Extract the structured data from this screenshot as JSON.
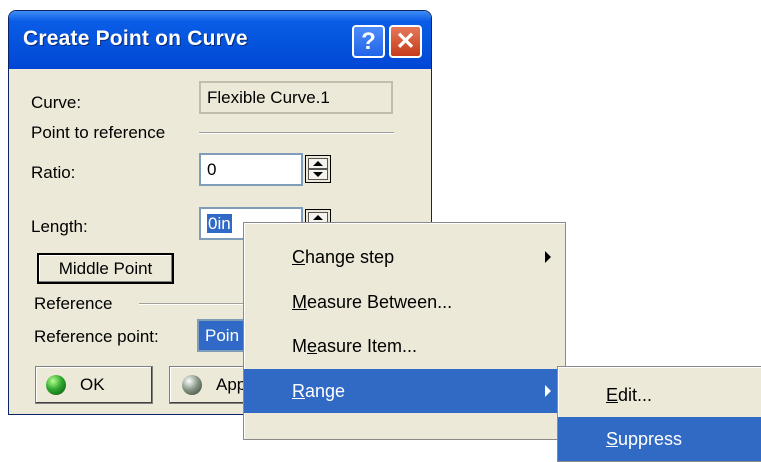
{
  "dialog": {
    "title": "Create Point on Curve",
    "help_glyph": "?",
    "close_glyph": "✕",
    "curve_label": "Curve:",
    "curve_value": "Flexible Curve.1",
    "point_to_reference_label": "Point to reference",
    "ratio_label": "Ratio:",
    "ratio_value": "0",
    "length_label": "Length:",
    "length_value": "0in",
    "middle_point_label": "Middle Point",
    "reference_label": "Reference",
    "reference_point_label": "Reference point:",
    "reference_point_value": "Poin",
    "ok_label": "OK",
    "apply_label": "App"
  },
  "context_menu": {
    "items": [
      {
        "label_first": "C",
        "label_rest": "hange step",
        "has_submenu": true
      },
      {
        "label_first": "M",
        "label_rest": "easure Between...",
        "has_submenu": false
      },
      {
        "label_pre": "M",
        "label_first": "e",
        "label_rest": "asure Item...",
        "has_submenu": false
      },
      {
        "label_first": "R",
        "label_rest": "ange",
        "has_submenu": true,
        "highlighted": true
      }
    ]
  },
  "submenu": {
    "items": [
      {
        "label_first": "E",
        "label_rest": "dit..."
      },
      {
        "label_first": "S",
        "label_rest": "uppress",
        "highlighted": true
      }
    ]
  },
  "colors": {
    "titlebar": "#0554dd",
    "highlight": "#316ac5",
    "dialog_bg": "#ece9d8"
  },
  "icons": [
    "help-icon",
    "close-icon",
    "spin-up-icon",
    "spin-down-icon",
    "submenu-arrow-icon",
    "ok-ball-icon",
    "apply-ball-icon"
  ]
}
